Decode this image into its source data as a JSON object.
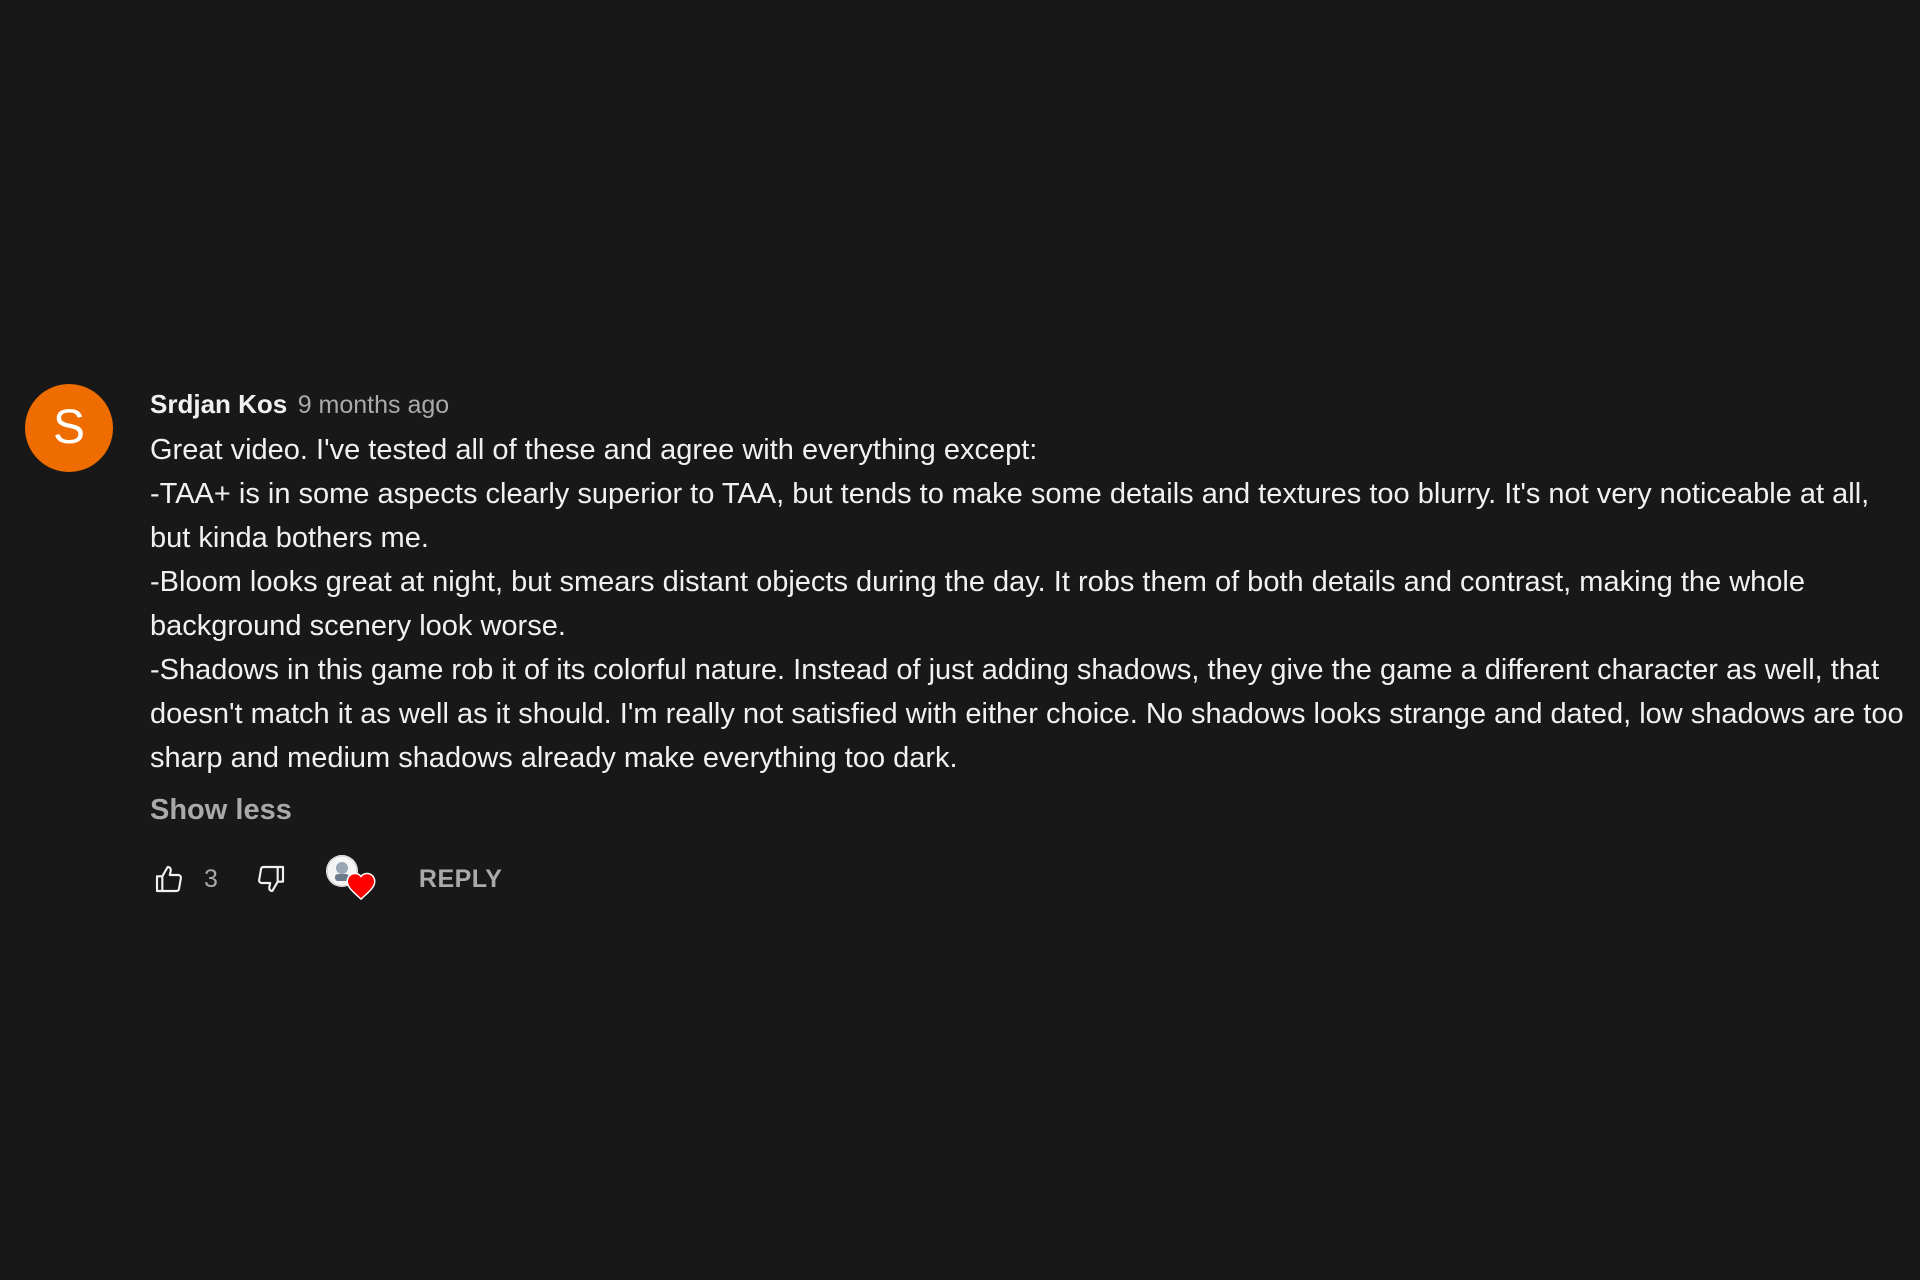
{
  "comment": {
    "avatar_letter": "S",
    "avatar_color": "#ef6c00",
    "author": "Srdjan Kos",
    "timestamp": "9 months ago",
    "paragraphs": [
      "Great video. I've tested all of these and agree with everything except:",
      "-TAA+ is in some aspects clearly superior to TAA, but tends to make some details and textures too blurry. It's not very noticeable at all, but kinda bothers me.",
      "-Bloom looks great at night, but smears distant objects during the day. It robs them of both details and contrast, making the whole background scenery look worse.",
      "-Shadows in this game rob it of its colorful nature. Instead of just adding shadows, they give the game a different character as well, that doesn't match it as well as it should. I'm really not satisfied with either choice. No shadows looks strange and dated, low shadows are too sharp and medium shadows already make everything too dark."
    ],
    "show_less_label": "Show less",
    "like_count": "3",
    "reply_label": "REPLY",
    "icons": {
      "like": "thumbs-up-icon",
      "dislike": "thumbs-down-icon",
      "creator_heart": "creator-heart-icon"
    },
    "heart_color": "#ff0000"
  }
}
